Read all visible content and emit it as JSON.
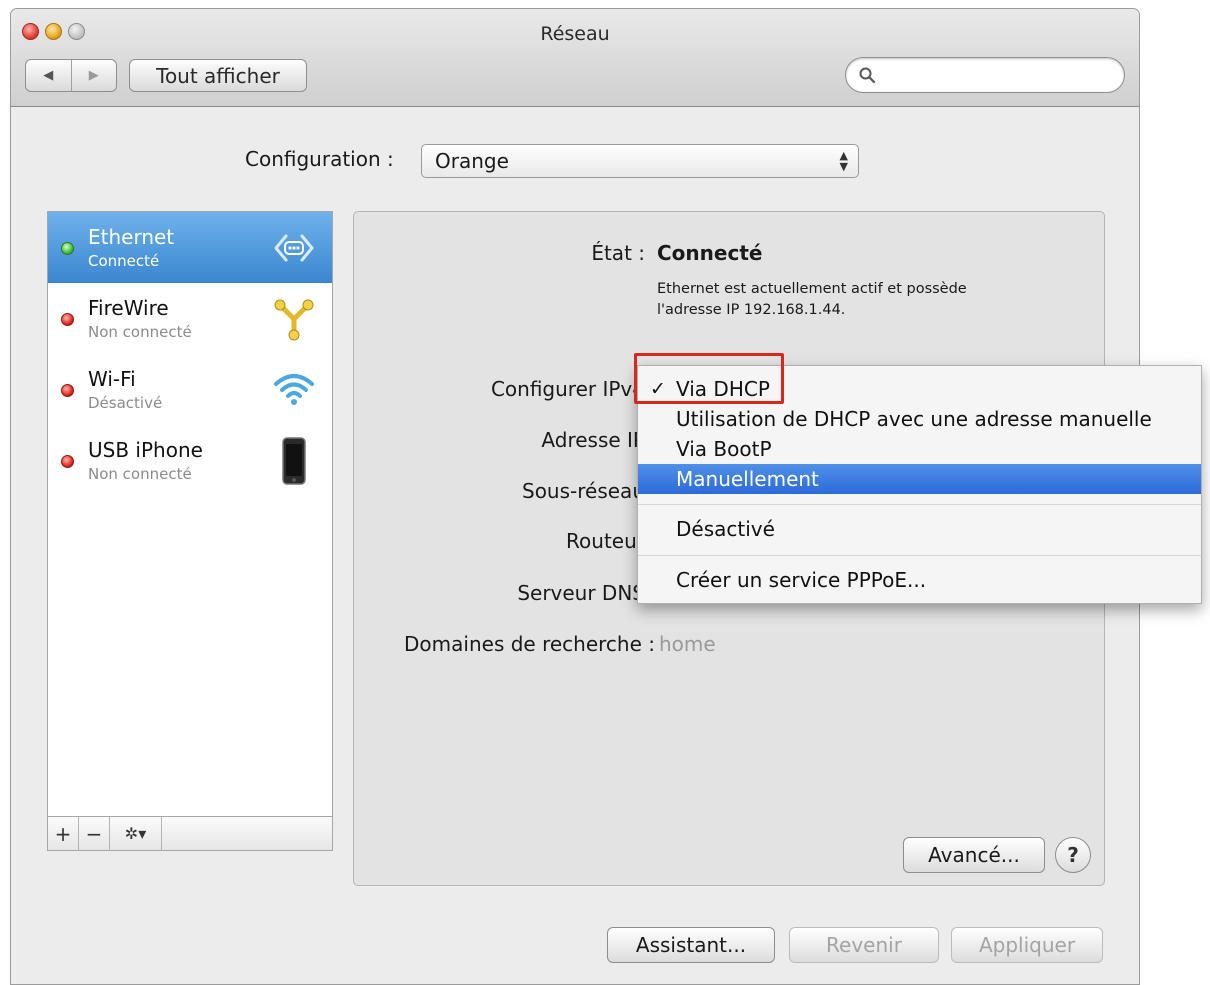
{
  "window": {
    "title": "Réseau",
    "show_all_label": "Tout afficher",
    "nav_back": "◀",
    "nav_forward": "▶",
    "search": {
      "placeholder": "",
      "value": ""
    }
  },
  "configuration": {
    "label": "Configuration :",
    "selected": "Orange"
  },
  "sidebar": {
    "services": [
      {
        "name": "Ethernet",
        "status": "Connecté",
        "indicator": "green",
        "icon": "ethernet-icon",
        "selected": true
      },
      {
        "name": "FireWire",
        "status": "Non connecté",
        "indicator": "red",
        "icon": "firewire-icon",
        "selected": false
      },
      {
        "name": "Wi-Fi",
        "status": "Désactivé",
        "indicator": "red",
        "icon": "wifi-icon",
        "selected": false
      },
      {
        "name": "USB iPhone",
        "status": "Non connecté",
        "indicator": "red",
        "icon": "iphone-icon",
        "selected": false
      }
    ],
    "footer": {
      "add": "+",
      "remove": "−",
      "gear": "✲▾"
    }
  },
  "detail": {
    "status_label": "État :",
    "status_value": "Connecté",
    "status_desc_line1": "Ethernet est actuellement actif et possède",
    "status_desc_line2": "l'adresse IP 192.168.1.44.",
    "ipv4_label": "Configurer IPv4",
    "ip_label": "Adresse IP",
    "subnet_label": "Sous-réseau",
    "router_label": "Routeur",
    "dns_label": "Serveur DNS",
    "search_domains_label": "Domaines de recherche :",
    "search_domains_value": "home",
    "advanced_label": "Avancé...",
    "help_label": "?"
  },
  "ipv4_menu": {
    "check": "✓",
    "items": [
      {
        "label": "Via DHCP",
        "checked": true,
        "highlighted": false
      },
      {
        "label": "Utilisation de DHCP avec une adresse manuelle",
        "checked": false,
        "highlighted": false
      },
      {
        "label": "Via BootP",
        "checked": false,
        "highlighted": false
      },
      {
        "label": "Manuellement",
        "checked": false,
        "highlighted": true
      },
      {
        "label": "Désactivé",
        "checked": false,
        "highlighted": false
      },
      {
        "label": "Créer un service PPPoE...",
        "checked": false,
        "highlighted": false
      }
    ]
  },
  "footer_buttons": {
    "assistant": "Assistant...",
    "revert": "Revenir",
    "apply": "Appliquer"
  },
  "colors": {
    "selection_blue": "#3b86d1",
    "menu_highlight": "#2c6ad8",
    "annotation_red": "#d8281e"
  }
}
